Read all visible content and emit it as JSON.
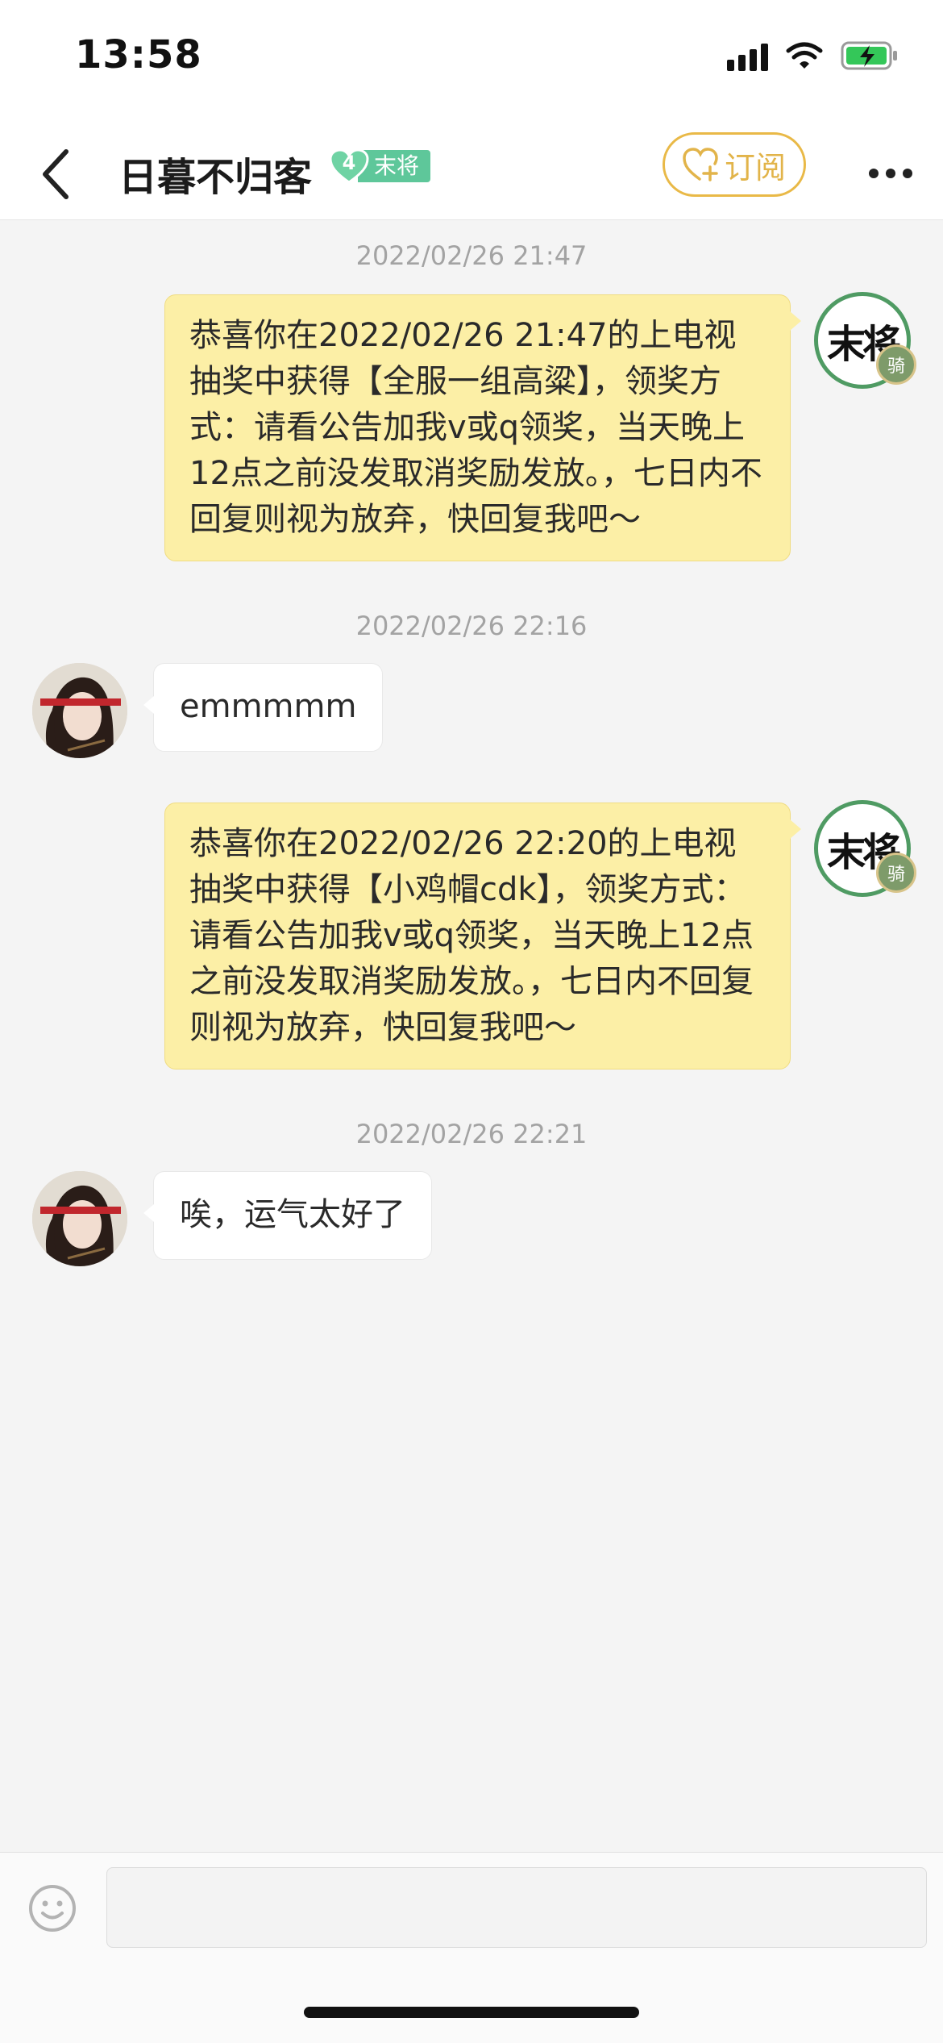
{
  "status_bar": {
    "time": "13:58"
  },
  "header": {
    "title": "日暮不归客",
    "level_number": "4",
    "level_rank": "末将",
    "subscribe_label": "订阅"
  },
  "messages": [
    {
      "kind": "time",
      "text": "2022/02/26 21:47"
    },
    {
      "kind": "sent",
      "text": "恭喜你在2022/02/26 21:47的上电视抽奖中获得【全服一组高粱】，领奖方式：请看公告加我v或q领奖，当天晚上12点之前没发取消奖励发放。，七日内不回复则视为放弃，快回复我吧～"
    },
    {
      "kind": "time",
      "text": "2022/02/26 22:16"
    },
    {
      "kind": "received",
      "text": "emmmmm"
    },
    {
      "kind": "sent",
      "text": "恭喜你在2022/02/26 22:20的上电视抽奖中获得【小鸡帽cdk】，领奖方式：请看公告加我v或q领奖，当天晚上12点之前没发取消奖励发放。，七日内不回复则视为放弃，快回复我吧～"
    },
    {
      "kind": "time",
      "text": "2022/02/26 22:21"
    },
    {
      "kind": "received",
      "text": "唉，运气太好了"
    }
  ],
  "sender_avatar": {
    "rank_text": "末将",
    "badge_text": "骑"
  },
  "input": {
    "value": ""
  },
  "colors": {
    "accent": "#e9b947",
    "sent_bubble": "#fcefa6",
    "rank_green": "#5ec79a"
  }
}
